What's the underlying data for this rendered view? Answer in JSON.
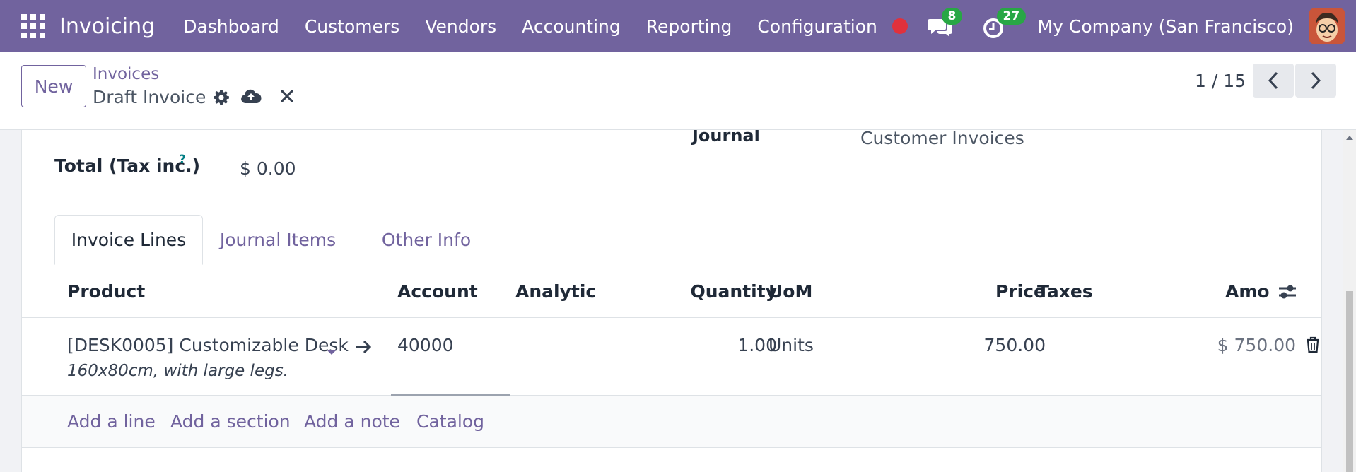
{
  "navbar": {
    "app_name": "Invoicing",
    "menu": [
      "Dashboard",
      "Customers",
      "Vendors",
      "Accounting",
      "Reporting",
      "Configuration"
    ],
    "messages_count": "8",
    "activities_count": "27",
    "company": "My Company (San Francisco)"
  },
  "control": {
    "new_label": "New",
    "breadcrumb_parent": "Invoices",
    "breadcrumb_current": "Draft Invoice",
    "pager": "1 / 15"
  },
  "form": {
    "journal_label": "Journal",
    "journal_value": "Customer Invoices",
    "total_label": "Total (Tax inc.)",
    "total_help": "?",
    "total_value": "$ 0.00"
  },
  "tabs": [
    "Invoice Lines",
    "Journal Items",
    "Other Info"
  ],
  "table": {
    "headers": {
      "product": "Product",
      "account": "Account",
      "analytic": "Analytic",
      "quantity": "Quantity",
      "uom": "UoM",
      "price": "Price",
      "taxes": "Taxes",
      "amount": "Amou"
    },
    "row": {
      "product": "[DESK0005] Customizable Desk",
      "description": "160x80cm, with large legs.",
      "account": "40000",
      "analytic": "",
      "quantity": "1.00",
      "uom": "Units",
      "price": "750.00",
      "taxes": "",
      "amount": "$ 750.00"
    },
    "add_links": [
      "Add a line",
      "Add a section",
      "Add a note",
      "Catalog"
    ]
  },
  "colors": {
    "brand": "#71639e",
    "badge": "#28a745",
    "record": "#e0313c"
  },
  "icons": [
    "apps-grid-icon",
    "chat-icon",
    "clock-icon",
    "gear-icon",
    "cloud-upload-icon",
    "close-icon",
    "chevron-left-icon",
    "chevron-right-icon",
    "caret-down-icon",
    "arrow-right-icon",
    "column-settings-icon",
    "trash-icon"
  ]
}
